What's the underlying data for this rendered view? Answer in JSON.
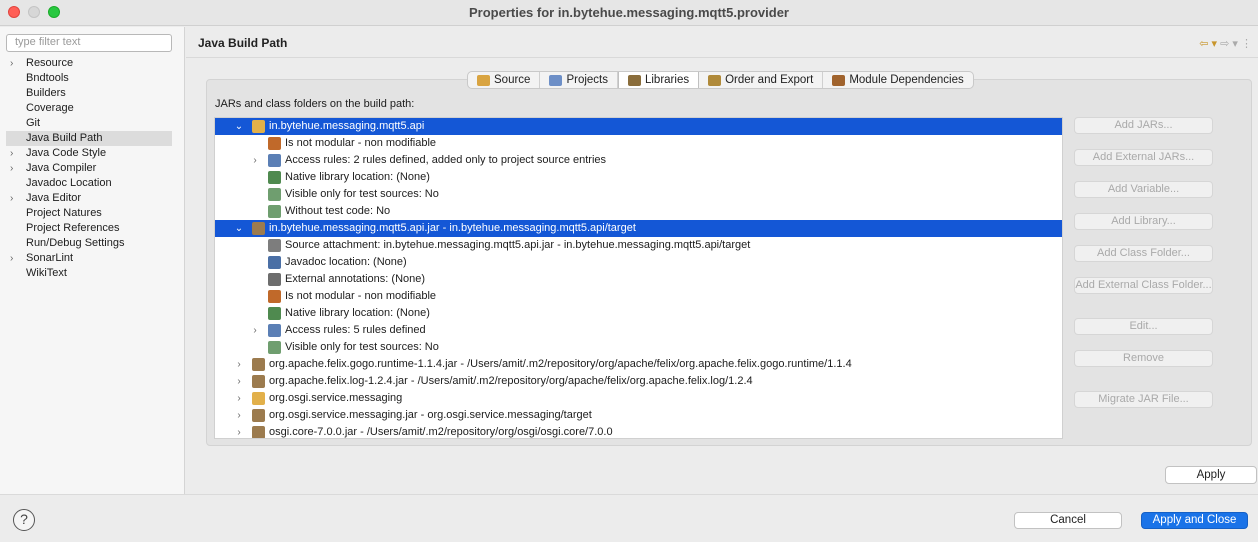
{
  "window": {
    "title": "Properties for in.bytehue.messaging.mqtt5.provider"
  },
  "filter": {
    "placeholder": "type filter text"
  },
  "nav": {
    "items": [
      {
        "label": "Resource",
        "expandable": true
      },
      {
        "label": "Bndtools",
        "expandable": false
      },
      {
        "label": "Builders",
        "expandable": false
      },
      {
        "label": "Coverage",
        "expandable": false
      },
      {
        "label": "Git",
        "expandable": false
      },
      {
        "label": "Java Build Path",
        "expandable": false,
        "selected": true
      },
      {
        "label": "Java Code Style",
        "expandable": true
      },
      {
        "label": "Java Compiler",
        "expandable": true
      },
      {
        "label": "Javadoc Location",
        "expandable": false
      },
      {
        "label": "Java Editor",
        "expandable": true
      },
      {
        "label": "Project Natures",
        "expandable": false
      },
      {
        "label": "Project References",
        "expandable": false
      },
      {
        "label": "Run/Debug Settings",
        "expandable": false
      },
      {
        "label": "SonarLint",
        "expandable": true
      },
      {
        "label": "WikiText",
        "expandable": false
      }
    ]
  },
  "page": {
    "title": "Java Build Path"
  },
  "tabs": [
    {
      "label": "Source",
      "icon": "source-folder-icon",
      "color": "#d9a441"
    },
    {
      "label": "Projects",
      "icon": "project-icon",
      "color": "#6d8fc7"
    },
    {
      "label": "Libraries",
      "icon": "library-icon",
      "color": "#8a6d3b",
      "active": true
    },
    {
      "label": "Order and Export",
      "icon": "order-export-icon",
      "color": "#b08a3a"
    },
    {
      "label": "Module Dependencies",
      "icon": "module-icon",
      "color": "#a0632d"
    }
  ],
  "list_label": "JARs and class folders on the build path:",
  "tree": [
    {
      "text": "in.bytehue.messaging.mqtt5.api",
      "level": 0,
      "chevron": "down",
      "selected": true,
      "icon": "project-folder-icon"
    },
    {
      "text": "Is not modular - non modifiable",
      "level": 1,
      "chevron": "",
      "icon": "module-attr-icon"
    },
    {
      "text": "Access rules: 2 rules defined, added only to project source entries",
      "level": 1,
      "chevron": "right",
      "icon": "access-rules-icon"
    },
    {
      "text": "Native library location: (None)",
      "level": 1,
      "chevron": "",
      "icon": "native-lib-icon"
    },
    {
      "text": "Visible only for test sources: No",
      "level": 1,
      "chevron": "",
      "icon": "test-icon"
    },
    {
      "text": "Without test code: No",
      "level": 1,
      "chevron": "",
      "icon": "test-icon"
    },
    {
      "text": "in.bytehue.messaging.mqtt5.api.jar - in.bytehue.messaging.mqtt5.api/target",
      "level": 0,
      "chevron": "down",
      "selected": true,
      "icon": "jar-icon"
    },
    {
      "text": "Source attachment: in.bytehue.messaging.mqtt5.api.jar - in.bytehue.messaging.mqtt5.api/target",
      "level": 1,
      "chevron": "",
      "icon": "source-attachment-icon"
    },
    {
      "text": "Javadoc location: (None)",
      "level": 1,
      "chevron": "",
      "icon": "javadoc-icon"
    },
    {
      "text": "External annotations: (None)",
      "level": 1,
      "chevron": "",
      "icon": "annotations-icon"
    },
    {
      "text": "Is not modular - non modifiable",
      "level": 1,
      "chevron": "",
      "icon": "module-attr-icon"
    },
    {
      "text": "Native library location: (None)",
      "level": 1,
      "chevron": "",
      "icon": "native-lib-icon"
    },
    {
      "text": "Access rules: 5 rules defined",
      "level": 1,
      "chevron": "right",
      "icon": "access-rules-icon"
    },
    {
      "text": "Visible only for test sources: No",
      "level": 1,
      "chevron": "",
      "icon": "test-icon"
    },
    {
      "text": "org.apache.felix.gogo.runtime-1.1.4.jar - /Users/amit/.m2/repository/org/apache/felix/org.apache.felix.gogo.runtime/1.1.4",
      "level": 0,
      "chevron": "right",
      "icon": "jar-icon"
    },
    {
      "text": "org.apache.felix.log-1.2.4.jar - /Users/amit/.m2/repository/org/apache/felix/org.apache.felix.log/1.2.4",
      "level": 0,
      "chevron": "right",
      "icon": "jar-icon"
    },
    {
      "text": "org.osgi.service.messaging",
      "level": 0,
      "chevron": "right",
      "icon": "project-folder-icon"
    },
    {
      "text": "org.osgi.service.messaging.jar - org.osgi.service.messaging/target",
      "level": 0,
      "chevron": "right",
      "icon": "jar-icon"
    },
    {
      "text": "osgi.core-7.0.0.jar - /Users/amit/.m2/repository/org/osgi/osgi.core/7.0.0",
      "level": 0,
      "chevron": "right",
      "icon": "jar-icon"
    }
  ],
  "side_buttons": [
    {
      "label": "Add JARs..."
    },
    {
      "label": "Add External JARs..."
    },
    {
      "label": "Add Variable..."
    },
    {
      "label": "Add Library..."
    },
    {
      "label": "Add Class Folder..."
    },
    {
      "label": "Add External Class Folder..."
    },
    {
      "label": "Edit..."
    },
    {
      "label": "Remove"
    },
    {
      "label": "Migrate JAR File..."
    }
  ],
  "buttons": {
    "apply": "Apply",
    "cancel": "Cancel",
    "apply_close": "Apply and Close",
    "help": "?"
  },
  "colors": {
    "selection": "#1457d6",
    "primary_button": "#1a73e8"
  }
}
